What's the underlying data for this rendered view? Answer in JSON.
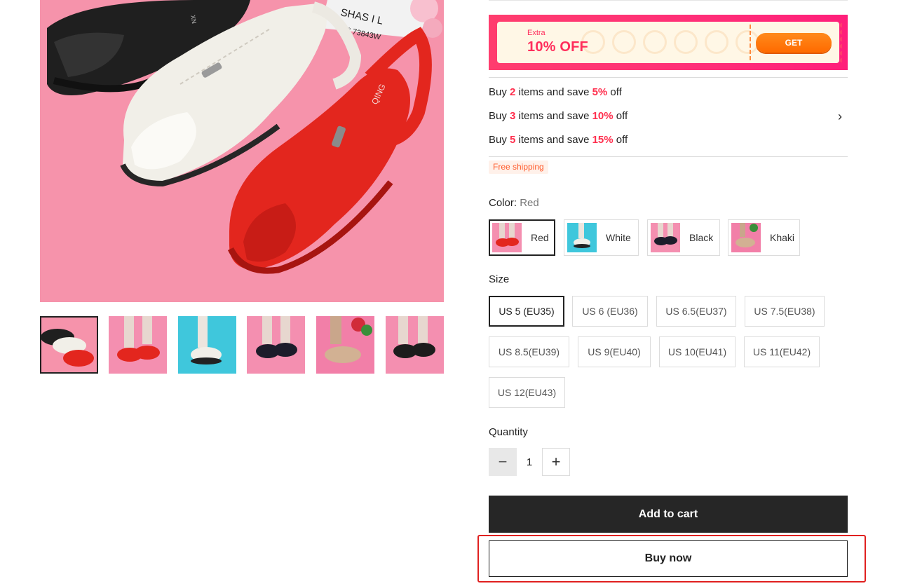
{
  "gallery": {
    "main_image_alt": "",
    "main_image_text": [
      "XN",
      "SHAS I L",
      "N° 73843W",
      "QING"
    ],
    "thumbnail_count": 6,
    "next_label": "›"
  },
  "coupon": {
    "extra_label": "Extra",
    "value": "10% OFF",
    "button_label": "GET"
  },
  "discounts": [
    {
      "prefix": "Buy ",
      "qty": "2",
      "middle": " items and save ",
      "pct": "5%",
      "suffix": " off"
    },
    {
      "prefix": "Buy ",
      "qty": "3",
      "middle": " items and save ",
      "pct": "10%",
      "suffix": " off"
    },
    {
      "prefix": "Buy ",
      "qty": "5",
      "middle": " items and save ",
      "pct": "15%",
      "suffix": " off"
    }
  ],
  "free_shipping": "Free shipping",
  "color": {
    "label": "Color:",
    "selected": "Red",
    "options": [
      "Red",
      "White",
      "Black",
      "Khaki"
    ]
  },
  "size": {
    "label": "Size",
    "options": [
      "US 5 (EU35)",
      "US 6 (EU36)",
      "US 6.5(EU37)",
      "US 7.5(EU38)",
      "US 8.5(EU39)",
      "US 9(EU40)",
      "US 10(EU41)",
      "US 11(EU42)",
      "US 12(EU43)"
    ],
    "selected": "US 5 (EU35)"
  },
  "quantity": {
    "label": "Quantity",
    "value": "1",
    "minus": "−",
    "plus": "+"
  },
  "actions": {
    "add_to_cart": "Add to cart",
    "buy_now": "Buy now"
  },
  "colors": {
    "accent_red": "#ff2e4d",
    "coupon_pink": "#ff2e78",
    "coupon_orange": "#ff6a00",
    "dark_button": "#262626",
    "highlight": "#e0201f"
  }
}
